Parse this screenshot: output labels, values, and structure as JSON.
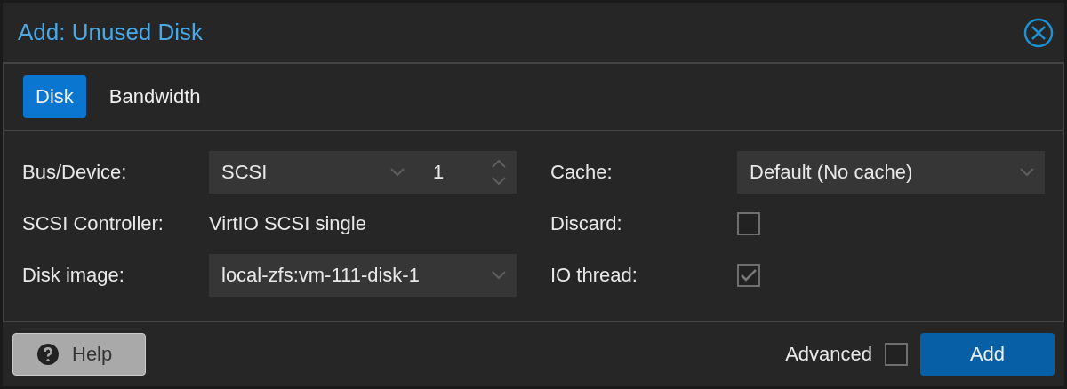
{
  "dialog": {
    "title": "Add: Unused Disk"
  },
  "tabs": [
    {
      "label": "Disk",
      "selected": true
    },
    {
      "label": "Bandwidth",
      "selected": false
    }
  ],
  "left_fields": [
    {
      "kind": "combo",
      "label": "Bus/Device:",
      "value": "SCSI",
      "number": "1"
    },
    {
      "kind": "display",
      "label": "SCSI Controller:",
      "value": "VirtIO SCSI single"
    },
    {
      "kind": "select",
      "label": "Disk image:",
      "value": "local-zfs:vm-111-disk-1"
    }
  ],
  "right_fields": [
    {
      "kind": "select",
      "label": "Cache:",
      "value": "Default (No cache)"
    },
    {
      "kind": "checkbox",
      "label": "Discard:",
      "checked": false
    },
    {
      "kind": "checkbox",
      "label": "IO thread:",
      "checked": true
    }
  ],
  "footer": {
    "help": "Help",
    "advanced": {
      "label": "Advanced",
      "checked": false
    },
    "submit": "Add"
  }
}
